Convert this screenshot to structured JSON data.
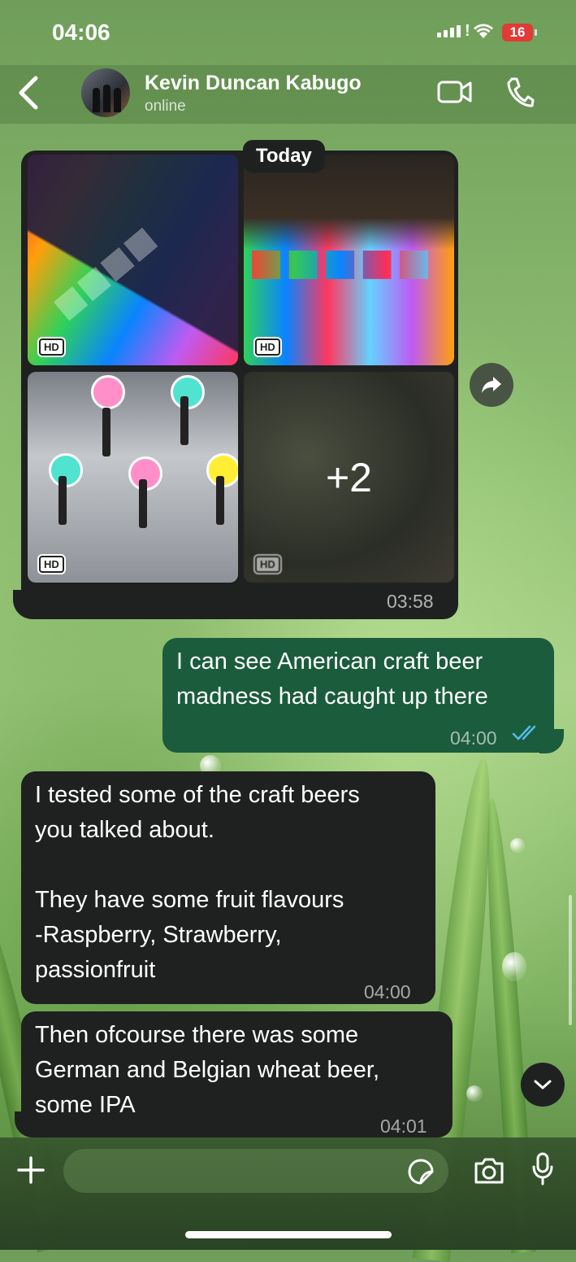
{
  "status_bar": {
    "time": "04:06",
    "battery": "16"
  },
  "header": {
    "contact_name": "Kevin Duncan Kabugo",
    "contact_status": "online"
  },
  "date_separator": "Today",
  "media_message": {
    "tiles": [
      {
        "badge": "HD"
      },
      {
        "badge": "HD"
      },
      {
        "badge": "HD"
      },
      {
        "badge": "HD"
      }
    ],
    "more_count": "+2",
    "time": "03:58"
  },
  "messages": [
    {
      "direction": "outgoing",
      "text": "I can see American craft beer\nmadness had caught up there",
      "time": "04:00",
      "read": true
    },
    {
      "direction": "incoming",
      "text": "I tested some of the craft beers\nyou talked about.\n\nThey have some fruit flavours\n-Raspberry,  Strawberry,\npassionfruit",
      "time": "04:00"
    },
    {
      "direction": "incoming",
      "text": "Then ofcourse there was some\nGerman and Belgian wheat beer,\nsome IPA",
      "time": "04:01"
    }
  ],
  "composer": {
    "placeholder": ""
  },
  "colors": {
    "incoming_bubble": "#1f2121",
    "outgoing_bubble": "#1a5c3c",
    "read_ticks": "#53bdeb",
    "battery_low": "#e23a36"
  },
  "icons": [
    "back-chevron-icon",
    "video-call-icon",
    "voice-call-icon",
    "forward-icon",
    "chevron-down-icon",
    "plus-icon",
    "sticker-icon",
    "camera-icon",
    "microphone-icon"
  ]
}
